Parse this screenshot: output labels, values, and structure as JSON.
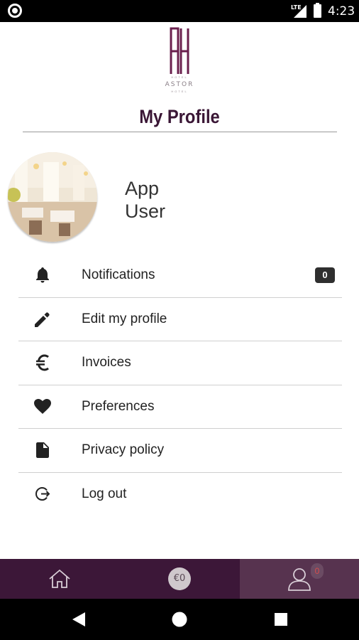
{
  "status_bar": {
    "network": "LTE",
    "time": "4:23"
  },
  "logo": {
    "monogram": "AH",
    "top_line": "HOTEL",
    "name": "ASTOR",
    "bottom_line": "HOTEL"
  },
  "page": {
    "title": "My Profile"
  },
  "profile": {
    "first_name": "App",
    "last_name": "User"
  },
  "menu": {
    "items": [
      {
        "label": "Notifications",
        "icon": "bell-icon",
        "badge": "0"
      },
      {
        "label": "Edit my profile",
        "icon": "pencil-icon"
      },
      {
        "label": "Invoices",
        "icon": "euro-icon"
      },
      {
        "label": "Preferences",
        "icon": "heart-icon"
      },
      {
        "label": "Privacy policy",
        "icon": "document-icon"
      },
      {
        "label": "Log out",
        "icon": "logout-icon"
      }
    ]
  },
  "bottom_nav": {
    "wallet_label": "€0",
    "profile_badge": "0",
    "tabs": [
      {
        "name": "home",
        "icon": "home-icon"
      },
      {
        "name": "wallet",
        "icon": "wallet-icon"
      },
      {
        "name": "profile",
        "icon": "profile-icon",
        "active": true
      }
    ]
  },
  "colors": {
    "brand": "#3c1738",
    "brand_active": "#57334f",
    "title": "#3a1635"
  }
}
